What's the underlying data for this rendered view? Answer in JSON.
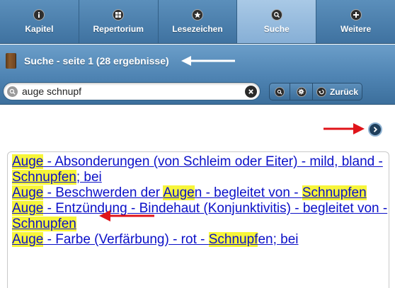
{
  "tabs": [
    {
      "label": "Kapitel",
      "icon": "info-icon",
      "active": false
    },
    {
      "label": "Repertorium",
      "icon": "grid-icon",
      "active": false
    },
    {
      "label": "Lesezeichen",
      "icon": "star-icon",
      "active": false
    },
    {
      "label": "Suche",
      "icon": "search-icon",
      "active": true
    },
    {
      "label": "Weitere",
      "icon": "plus-icon",
      "active": false
    }
  ],
  "title": "Suche - seite 1 (28 ergebnisse)",
  "search": {
    "value": "auge schnupf",
    "back_label": "Zurück"
  },
  "results": [
    {
      "segments": [
        {
          "text": "Auge",
          "hl": true
        },
        {
          "text": " - Absonderungen (von Schleim oder Eiter) - mild, bland - ",
          "hl": false
        },
        {
          "text": "Schnupfen",
          "hl": true
        },
        {
          "text": "; bei",
          "hl": false
        }
      ]
    },
    {
      "segments": [
        {
          "text": "Auge",
          "hl": true
        },
        {
          "text": " - Beschwerden der ",
          "hl": false
        },
        {
          "text": "Auge",
          "hl": true
        },
        {
          "text": "n - begleitet von - ",
          "hl": false
        },
        {
          "text": "Schnupfen",
          "hl": true
        }
      ]
    },
    {
      "segments": [
        {
          "text": "Auge",
          "hl": true
        },
        {
          "text": " - Entzündung - Bindehaut (Konjunktivitis) - begleitet von - ",
          "hl": false
        },
        {
          "text": "Schnupfen",
          "hl": true
        }
      ]
    },
    {
      "segments": [
        {
          "text": "Auge",
          "hl": true
        },
        {
          "text": " - Farbe (Verfärbung) - rot - ",
          "hl": false
        },
        {
          "text": "Schnupf",
          "hl": true
        },
        {
          "text": "en; bei",
          "hl": false
        }
      ]
    }
  ],
  "colors": {
    "accent": "#4f84b3",
    "active_tab": "#a9c9e6",
    "link": "#0b10c8",
    "highlight": "#f7f53a",
    "annotation_arrow": "#e0141a"
  }
}
